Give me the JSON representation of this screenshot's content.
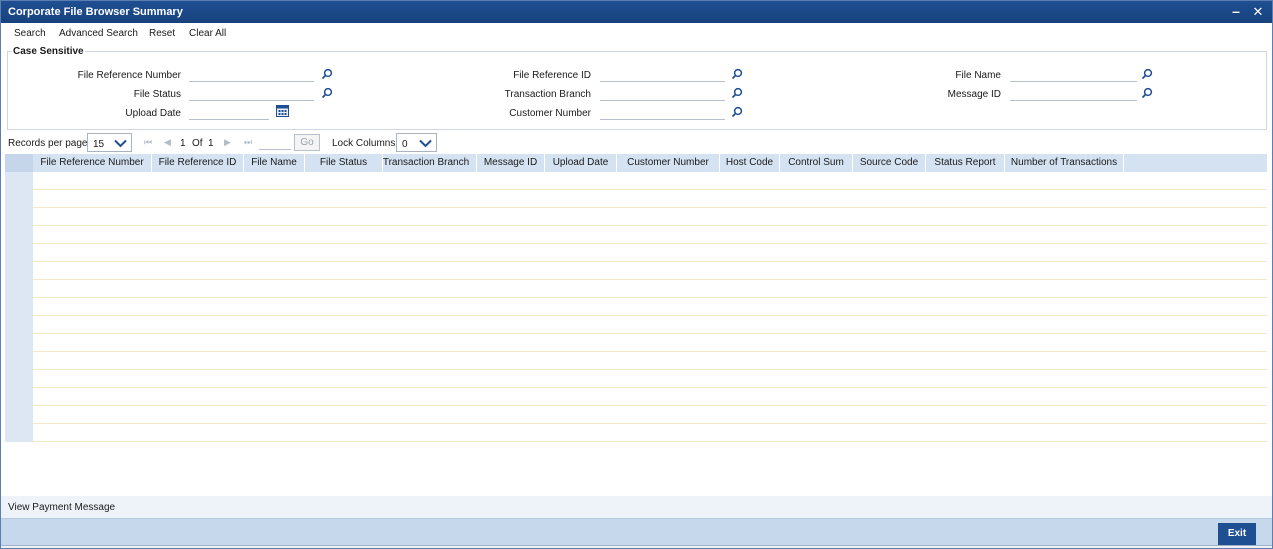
{
  "window": {
    "title": "Corporate File Browser Summary",
    "minimize": "–",
    "close": "✕"
  },
  "toolbar": {
    "search": "Search",
    "advanced_search": "Advanced Search",
    "reset": "Reset",
    "clear_all": "Clear All"
  },
  "criteria": {
    "section_label": "Case Sensitive",
    "fields": {
      "file_reference_number": {
        "label": "File Reference Number",
        "value": ""
      },
      "file_status": {
        "label": "File Status",
        "value": ""
      },
      "upload_date": {
        "label": "Upload Date",
        "value": ""
      },
      "file_reference_id": {
        "label": "File Reference ID",
        "value": ""
      },
      "transaction_branch": {
        "label": "Transaction Branch",
        "value": ""
      },
      "customer_number": {
        "label": "Customer Number",
        "value": ""
      },
      "file_name": {
        "label": "File Name",
        "value": ""
      },
      "message_id": {
        "label": "Message ID",
        "value": ""
      }
    }
  },
  "pager": {
    "records_per_page_label": "Records per page",
    "records_per_page": "15",
    "current_page": "1",
    "of_label": "Of",
    "total_pages": "1",
    "go_label": "Go",
    "lock_columns_label": "Lock Columns",
    "lock_columns": "0"
  },
  "grid": {
    "columns": [
      "File Reference Number",
      "File Reference ID",
      "File Name",
      "File Status",
      "Transaction Branch",
      "Message ID",
      "Upload Date",
      "Customer Number",
      "Host Code",
      "Control Sum",
      "Source Code",
      "Status Report",
      "Number of Transactions"
    ],
    "row_count": 15
  },
  "footer": {
    "view_payment_message": "View Payment Message",
    "exit": "Exit"
  },
  "colors": {
    "title_bar": "#1f4f93",
    "header_bg": "#d4e2f2",
    "footer_bg": "#c5d8ec",
    "exit_button": "#1f4f93"
  }
}
